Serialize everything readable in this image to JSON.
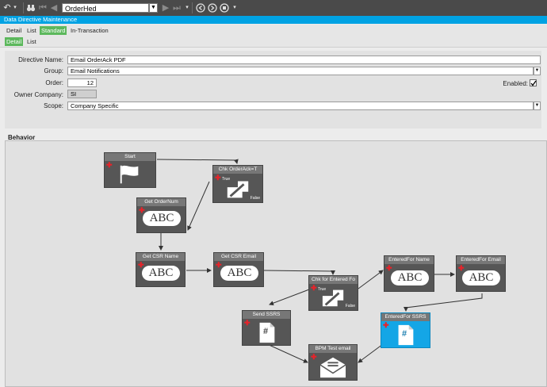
{
  "toolbar": {
    "icons": [
      "undo-icon",
      "binoculars-icon",
      "first-record-icon",
      "previous-record-icon",
      "next-record-icon",
      "last-record-icon",
      "navigate-back-icon",
      "navigate-forward-icon",
      "stop-icon"
    ],
    "combo_value": "OrderHed"
  },
  "title": "Data Directive Maintenance",
  "tabs": [
    "Detail",
    "List",
    "Standard",
    "In-Transaction"
  ],
  "subtabs": [
    "Detail",
    "List"
  ],
  "form": {
    "directive_name_label": "Directive Name:",
    "directive_name_value": "Email OrderAck PDF",
    "group_label": "Group:",
    "group_value": "Email Notifications",
    "order_label": "Order:",
    "order_value": "12",
    "owner_label": "Owner Company:",
    "owner_value": "SI",
    "scope_label": "Scope:",
    "scope_value": "Company Specific",
    "enabled_label": "Enabled:",
    "enabled_checked": true
  },
  "behavior": {
    "label": "Behavior",
    "nodes": {
      "start": "Start",
      "chk_orderack": "Chk OrderAck=T",
      "get_ordernum": "Get OrderNum",
      "get_csr_name": "Get CSR Name",
      "get_csr_email": "Get CSR Email",
      "chk_entered": "Chk for Entered Fo",
      "enteredfor_name": "EnteredFor Name",
      "enteredfor_email": "EnteredFor Email",
      "send_ssrs": "Send SSRS",
      "enteredfor_ssrs": "EnteredFor SSRS",
      "bpm_test_email": "BPM Test email"
    },
    "true_label": "True",
    "false_label": "False",
    "abc_text": "ABC",
    "hash_text": "#"
  }
}
